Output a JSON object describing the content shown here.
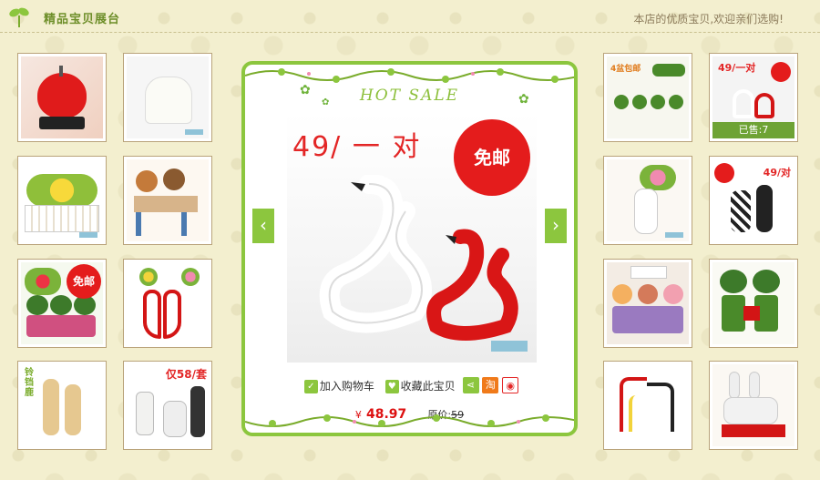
{
  "header": {
    "title": "精品宝贝展台",
    "slogan": "本店的优质宝贝,欢迎亲们选购!"
  },
  "colors": {
    "accent": "#8cc63e",
    "price": "#dd1111",
    "promo": "#e32626",
    "background": "#f3efcf"
  },
  "left_thumbs": [
    {
      "name": "red-apple-ornament",
      "tag": "",
      "overlay": ""
    },
    {
      "name": "white-elephant-figurine",
      "tag": "",
      "overlay": ""
    },
    {
      "name": "yellow-flower-fence",
      "tag": "",
      "overlay": ""
    },
    {
      "name": "cartoon-couple-dolls",
      "tag": "",
      "overlay": ""
    },
    {
      "name": "kids-dolls-free-ship",
      "tag": "",
      "overlay": "免邮"
    },
    {
      "name": "red-heart-vases",
      "tag": "",
      "overlay": ""
    },
    {
      "name": "deer-figurines",
      "tag": "",
      "overlay": "铃铛鹿"
    },
    {
      "name": "ceramic-vases",
      "tag": "",
      "overlay": "仅58/套"
    }
  ],
  "right_thumbs": [
    {
      "name": "green-trees-ornament",
      "tag": "",
      "overlay": "4盆包邮"
    },
    {
      "name": "swan-pair-small",
      "tag": "",
      "overlay": "49/一对",
      "sold": "已售:7"
    },
    {
      "name": "flower-vase",
      "tag": "",
      "overlay": ""
    },
    {
      "name": "black-white-vases",
      "tag": "",
      "overlay": "49/对"
    },
    {
      "name": "photo-dolls",
      "tag": "",
      "overlay": ""
    },
    {
      "name": "green-soldier-dolls",
      "tag": "",
      "overlay": ""
    },
    {
      "name": "coral-tree-ornament",
      "tag": "",
      "overlay": ""
    },
    {
      "name": "rabbit-dolls",
      "tag": "",
      "overlay": ""
    }
  ],
  "feature": {
    "banner": "HOT SALE",
    "promo_text": "49/ 一 对",
    "free_ship": "免邮",
    "prev_arrow": "‹",
    "next_arrow": "›",
    "actions": {
      "add_cart": "加入购物车",
      "favorite": "收藏此宝贝",
      "taobao": "淘"
    },
    "currency": "¥",
    "price": "48.97",
    "original_label": "原价:",
    "original_price": "59"
  }
}
